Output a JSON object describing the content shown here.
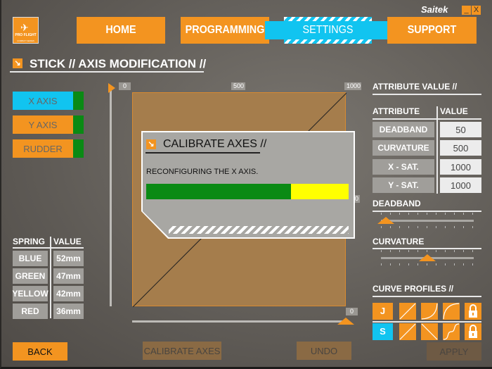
{
  "window": {
    "brand": "Saitek",
    "minimize_label": "_",
    "close_label": "X",
    "logo_text": "PRO FLIGHT",
    "logo_subtext": "COMBAT SERIES"
  },
  "nav": [
    {
      "label": "HOME",
      "active": false
    },
    {
      "label": "PROGRAMMING",
      "active": false
    },
    {
      "label": "SETTINGS",
      "active": true
    },
    {
      "label": "SUPPORT",
      "active": false
    }
  ],
  "page_title": "STICK //  AXIS MODIFICATION //",
  "axes": [
    {
      "label": "X AXIS",
      "selected": true
    },
    {
      "label": "Y AXIS",
      "selected": false
    },
    {
      "label": "RUDDER",
      "selected": false
    }
  ],
  "spring": {
    "header_name": "SPRING",
    "header_value": "VALUE",
    "rows": [
      {
        "name": "BLUE",
        "value": "52mm"
      },
      {
        "name": "GREEN",
        "value": "47mm"
      },
      {
        "name": "YELLOW",
        "value": "42mm"
      },
      {
        "name": "RED",
        "value": "36mm"
      }
    ]
  },
  "chart_labels": {
    "top_min": "0",
    "top_mid": "500",
    "top_max": "1000",
    "right_mid": "500",
    "bottom_right": "0"
  },
  "dialog": {
    "title": "CALIBRATE AXES //",
    "message": "RECONFIGURING THE X AXIS.",
    "progress_percent": 71.5
  },
  "attributes": {
    "title": "ATTRIBUTE VALUE //",
    "header_name": "ATTRIBUTE",
    "header_value": "VALUE",
    "rows": [
      {
        "name": "DEADBAND",
        "value": "50"
      },
      {
        "name": "CURVATURE",
        "value": "500"
      },
      {
        "name": "X - SAT.",
        "value": "1000"
      },
      {
        "name": "Y - SAT.",
        "value": "1000"
      }
    ]
  },
  "sliders": {
    "deadband_label": "DEADBAND",
    "deadband_value": 50,
    "curvature_label": "CURVATURE",
    "curvature_value": 500,
    "max": 1000
  },
  "curve_profiles": {
    "title": "CURVE PROFILES //",
    "row1_label": "J",
    "row2_label": "S",
    "row1_icons": [
      "linear-curve-icon",
      "exponential-curve-icon",
      "log-curve-icon",
      "lock-icon"
    ],
    "row2_icons": [
      "linear-curve-icon",
      "inverted-curve-icon",
      "s-curve-icon",
      "lock-icon"
    ]
  },
  "buttons": {
    "back": "BACK",
    "calibrate": "CALIBRATE AXES",
    "undo": "UNDO",
    "apply": "APPLY"
  },
  "colors": {
    "accent": "#f39420",
    "active": "#11c4f0",
    "progress_done": "#0a8a14",
    "progress_remaining": "#ffff00"
  }
}
